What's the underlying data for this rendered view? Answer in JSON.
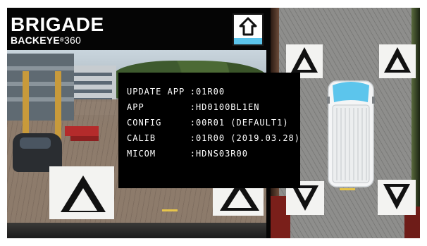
{
  "header": {
    "brand": "BRIGADE",
    "product_name": "BACKEYE",
    "product_number": "360"
  },
  "view_button": {
    "icon": "up-arrow-icon"
  },
  "info_panel": {
    "rows": [
      {
        "key": "UPDATE APP",
        "value": ":01R00"
      },
      {
        "key": "APP",
        "value": ":HD0100BL1EN"
      },
      {
        "key": "CONFIG",
        "value": ":00R01 (DEFAULT1)"
      },
      {
        "key": "CALIB",
        "value": ":01R00 (2019.03.28)"
      },
      {
        "key": "MICOM",
        "value": ":HDNS03R00"
      }
    ]
  },
  "colors": {
    "accent": "#5cc5ec",
    "background": "#050505",
    "text": "#ffffff"
  }
}
